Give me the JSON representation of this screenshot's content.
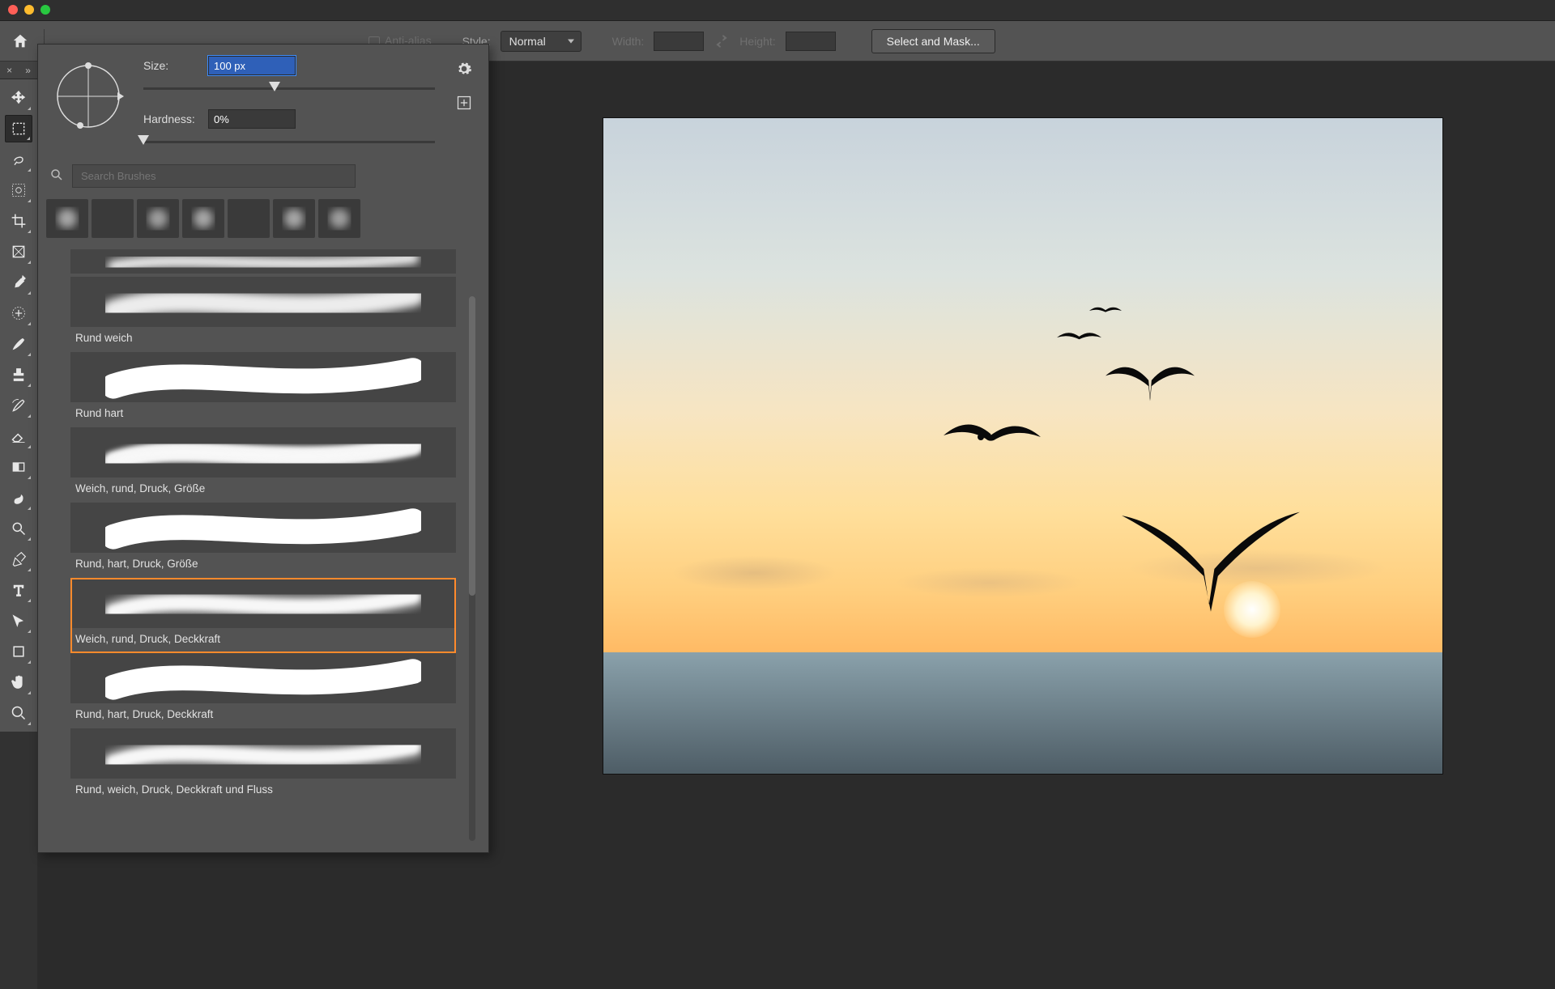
{
  "optbar": {
    "antialias_label": "Anti-alias",
    "style_label": "Style:",
    "style_value": "Normal",
    "width_label": "Width:",
    "height_label": "Height:",
    "select_mask_btn": "Select and Mask..."
  },
  "brushpanel": {
    "size_label": "Size:",
    "size_value": "100 px",
    "size_slider_pct": 45,
    "hardness_label": "Hardness:",
    "hardness_value": "0%",
    "hardness_slider_pct": 0,
    "search_placeholder": "Search Brushes",
    "tips": [
      {
        "kind": "soft",
        "opacity": 0.55
      },
      {
        "kind": "hard",
        "opacity": 1
      },
      {
        "kind": "soft",
        "opacity": 0.5
      },
      {
        "kind": "soft",
        "opacity": 0.55
      },
      {
        "kind": "hard",
        "opacity": 1
      },
      {
        "kind": "soft",
        "opacity": 0.55
      },
      {
        "kind": "soft",
        "opacity": 0.5
      }
    ],
    "list": [
      {
        "name": "",
        "style": "soft",
        "partial": true
      },
      {
        "name": "Rund weich",
        "style": "soft"
      },
      {
        "name": "Rund hart",
        "style": "hard"
      },
      {
        "name": "Weich, rund, Druck, Größe",
        "style": "softpress"
      },
      {
        "name": "Rund, hart, Druck, Größe",
        "style": "hardpress"
      },
      {
        "name": "Weich, rund, Druck, Deckkraft",
        "style": "softopacity",
        "selected": true
      },
      {
        "name": "Rund, hart, Druck, Deckkraft",
        "style": "hardopacity"
      },
      {
        "name": "Rund, weich, Druck, Deckkraft und Fluss",
        "style": "softflow"
      }
    ]
  },
  "tools": [
    {
      "id": "move",
      "name": "move-tool"
    },
    {
      "id": "marquee",
      "name": "rectangular-marquee-tool",
      "active": true
    },
    {
      "id": "lasso",
      "name": "lasso-tool"
    },
    {
      "id": "quicksel",
      "name": "quick-selection-tool"
    },
    {
      "id": "crop",
      "name": "crop-tool"
    },
    {
      "id": "frame",
      "name": "frame-tool"
    },
    {
      "id": "eyedrop",
      "name": "eyedropper-tool"
    },
    {
      "id": "heal",
      "name": "healing-brush-tool"
    },
    {
      "id": "brush",
      "name": "brush-tool"
    },
    {
      "id": "stamp",
      "name": "clone-stamp-tool"
    },
    {
      "id": "history",
      "name": "history-brush-tool"
    },
    {
      "id": "eraser",
      "name": "eraser-tool"
    },
    {
      "id": "gradient",
      "name": "gradient-tool"
    },
    {
      "id": "smudge",
      "name": "smudge-tool"
    },
    {
      "id": "dodge",
      "name": "dodge-tool"
    },
    {
      "id": "pen",
      "name": "pen-tool"
    },
    {
      "id": "type",
      "name": "type-tool"
    },
    {
      "id": "path",
      "name": "path-selection-tool"
    },
    {
      "id": "shape",
      "name": "rectangle-tool"
    },
    {
      "id": "hand",
      "name": "hand-tool"
    },
    {
      "id": "zoom",
      "name": "zoom-tool"
    }
  ]
}
